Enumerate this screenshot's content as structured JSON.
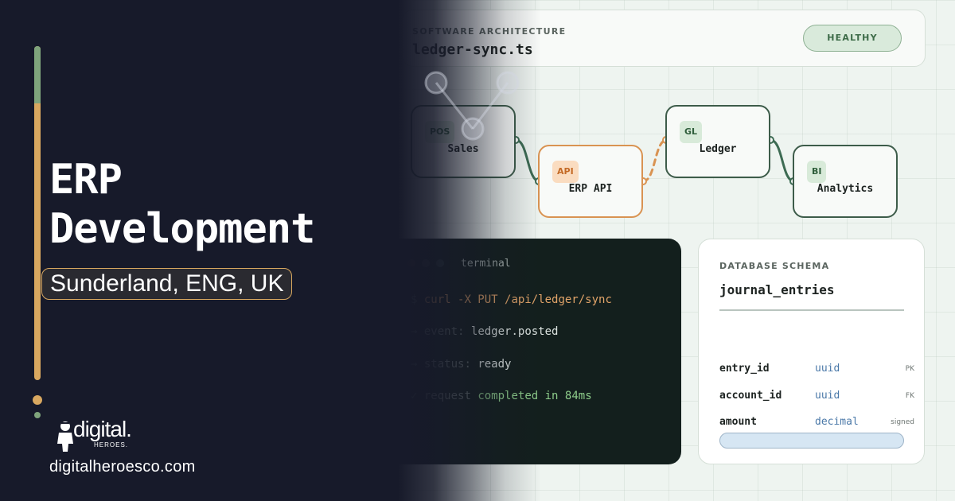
{
  "hero": {
    "title_line1": "ERP",
    "title_line2": "Development",
    "location": "Sunderland, ENG, UK",
    "logo_word": "digital.",
    "logo_sub": "HEROES.",
    "website": "digitalheroesco.com"
  },
  "header": {
    "eyebrow": "SOFTWARE ARCHITECTURE",
    "file_name": "ledger-sync.ts",
    "status_label": "HEALTHY"
  },
  "pipeline": {
    "nodes": [
      {
        "badge": "POS",
        "label": "Sales"
      },
      {
        "badge": "API",
        "label": "ERP API"
      },
      {
        "badge": "GL",
        "label": "Ledger"
      },
      {
        "badge": "BI",
        "label": "Analytics"
      }
    ]
  },
  "terminal": {
    "title": "terminal",
    "lines": [
      {
        "prefix": "$",
        "text": "curl -X PUT /api/ledger/sync"
      },
      {
        "prefix": "→",
        "key": "event:",
        "value": "ledger.posted"
      },
      {
        "prefix": "→",
        "key": "status:",
        "value": "ready"
      },
      {
        "prefix": "✓",
        "key": "request",
        "value": "completed in 84ms"
      }
    ]
  },
  "schema": {
    "eyebrow": "DATABASE SCHEMA",
    "table_name": "journal_entries",
    "columns": [
      {
        "name": "entry_id",
        "type": "uuid",
        "key": "PK"
      },
      {
        "name": "account_id",
        "type": "uuid",
        "key": "FK"
      },
      {
        "name": "amount",
        "type": "decimal",
        "key": "signed"
      }
    ]
  },
  "colors": {
    "dark_bg": "#171a2a",
    "accent_gold": "#d9a860",
    "accent_green": "#7fa47c",
    "node_border": "#3d5c4a",
    "api_orange": "#d99352",
    "terminal_bg": "#131f1d"
  }
}
